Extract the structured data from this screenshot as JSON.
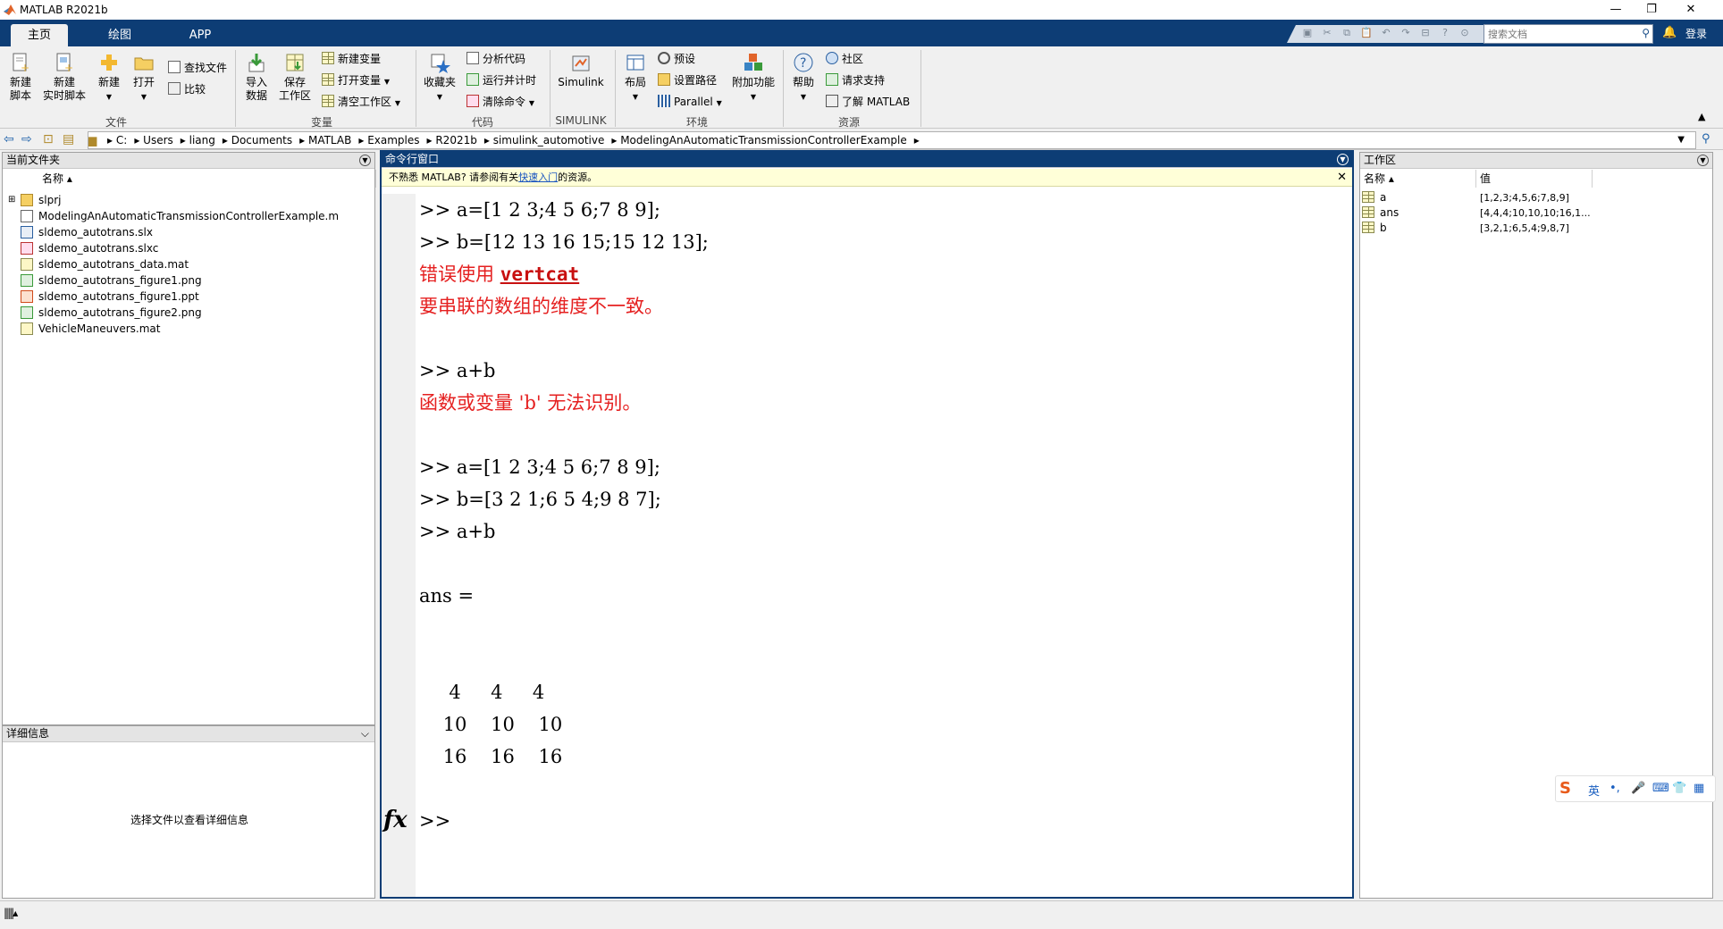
{
  "window": {
    "title": "MATLAB R2021b",
    "controls": [
      "—",
      "❐",
      "✕"
    ]
  },
  "tabs": [
    "主页",
    "绘图",
    "APP"
  ],
  "search": {
    "placeholder": "搜索文档"
  },
  "login": "登录",
  "ribbon": {
    "file_group": {
      "label": "文件",
      "new_script": "新建\n脚本",
      "new_live": "新建\n实时脚本",
      "new": "新建",
      "open": "打开",
      "find_files": "查找文件",
      "compare": "比较"
    },
    "var_group": {
      "label": "变量",
      "import": "导入\n数据",
      "save_ws": "保存\n工作区",
      "new_var": "新建变量",
      "open_var": "打开变量",
      "clear_ws": "清空工作区"
    },
    "code_group": {
      "label": "代码",
      "favorites": "收藏夹",
      "analyze": "分析代码",
      "run_time": "运行并计时",
      "clear_cmd": "清除命令"
    },
    "sim_group": {
      "label": "SIMULINK",
      "simulink": "Simulink"
    },
    "env_group": {
      "label": "环境",
      "layout": "布局",
      "prefs": "预设",
      "set_path": "设置路径",
      "parallel": "Parallel",
      "addons": "附加功能"
    },
    "res_group": {
      "label": "资源",
      "help": "帮助",
      "community": "社区",
      "support": "请求支持",
      "learn": "了解 MATLAB"
    }
  },
  "breadcrumbs": [
    "C:",
    "Users",
    "liang",
    "Documents",
    "MATLAB",
    "Examples",
    "R2021b",
    "simulink_automotive",
    "ModelingAnAutomaticTransmissionControllerExample"
  ],
  "current_folder": {
    "title": "当前文件夹",
    "col_name": "名称",
    "files": [
      {
        "name": "slprj",
        "icon": "folder"
      },
      {
        "name": "ModelingAnAutomaticTransmissionControllerExample.m",
        "icon": "m-file"
      },
      {
        "name": "sldemo_autotrans.slx",
        "icon": "slx"
      },
      {
        "name": "sldemo_autotrans.slxc",
        "icon": "slxc"
      },
      {
        "name": "sldemo_autotrans_data.mat",
        "icon": "mat"
      },
      {
        "name": "sldemo_autotrans_figure1.png",
        "icon": "png"
      },
      {
        "name": "sldemo_autotrans_figure1.ppt",
        "icon": "ppt"
      },
      {
        "name": "sldemo_autotrans_figure2.png",
        "icon": "png"
      },
      {
        "name": "VehicleManeuvers.mat",
        "icon": "mat"
      }
    ]
  },
  "details": {
    "title": "详细信息",
    "placeholder": "选择文件以查看详细信息"
  },
  "command_window": {
    "title": "命令行窗口",
    "notice_pre": "不熟悉 MATLAB? 请参阅有关",
    "notice_link": "快速入门",
    "notice_post": "的资源。",
    "lines": [
      {
        "type": "cmd",
        "text": ">> a=[1 2 3;4 5 6;7 8 9];"
      },
      {
        "type": "cmd",
        "text": ">> b=[12 13 16 15;15 12 13];"
      },
      {
        "type": "err_link",
        "pre": "错误使用 ",
        "link": "vertcat"
      },
      {
        "type": "err",
        "text": "要串联的数组的维度不一致。"
      },
      {
        "type": "blank",
        "text": ""
      },
      {
        "type": "cmd",
        "text": ">> a+b"
      },
      {
        "type": "err",
        "text": "函数或变量 'b' 无法识别。"
      },
      {
        "type": "blank",
        "text": ""
      },
      {
        "type": "cmd",
        "text": ">> a=[1 2 3;4 5 6;7 8 9];"
      },
      {
        "type": "cmd",
        "text": ">> b=[3 2 1;6 5 4;9 8 7];"
      },
      {
        "type": "cmd",
        "text": ">> a+b"
      },
      {
        "type": "blank",
        "text": ""
      },
      {
        "type": "out",
        "text": "ans ="
      },
      {
        "type": "blank",
        "text": ""
      },
      {
        "type": "blank",
        "text": ""
      },
      {
        "type": "out",
        "text": "     4     4     4"
      },
      {
        "type": "out",
        "text": "    10    10    10"
      },
      {
        "type": "out",
        "text": "    16    16    16"
      },
      {
        "type": "blank",
        "text": ""
      }
    ],
    "prompt": ">>",
    "fx": "fx"
  },
  "workspace": {
    "title": "工作区",
    "col_name": "名称",
    "col_value": "值",
    "vars": [
      {
        "name": "a",
        "value": "[1,2,3;4,5,6;7,8,9]"
      },
      {
        "name": "ans",
        "value": "[4,4,4;10,10,10;16,1..."
      },
      {
        "name": "b",
        "value": "[3,2,1;6,5,4;9,8,7]"
      }
    ]
  },
  "ime": {
    "lang": "英"
  }
}
